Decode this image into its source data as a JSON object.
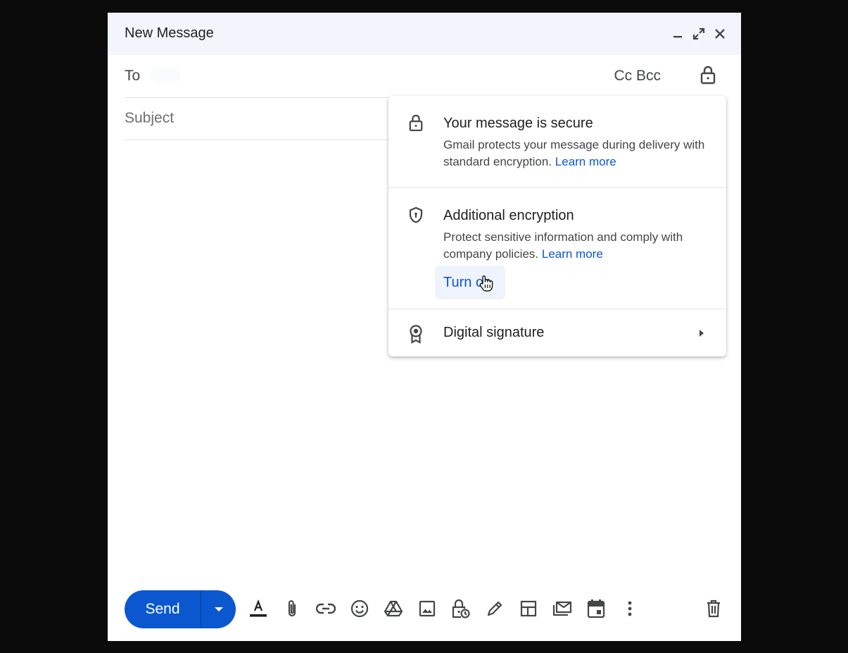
{
  "header": {
    "title": "New Message"
  },
  "to": {
    "label": "To",
    "cc": "Cc",
    "bcc": "Bcc"
  },
  "subject": {
    "placeholder": "Subject"
  },
  "security_popup": {
    "secure": {
      "title": "Your message is secure",
      "desc": "Gmail protects your message during delivery with standard encryption.",
      "link": "Learn more"
    },
    "encryption": {
      "title": "Additional encryption",
      "desc": "Protect sensitive information and comply with company policies.",
      "link": "Learn more",
      "button": "Turn on"
    },
    "signature": {
      "title": "Digital signature"
    }
  },
  "toolbar": {
    "send": "Send"
  },
  "colors": {
    "accent": "#0b57d0",
    "header_bg": "#f2f6fc"
  }
}
